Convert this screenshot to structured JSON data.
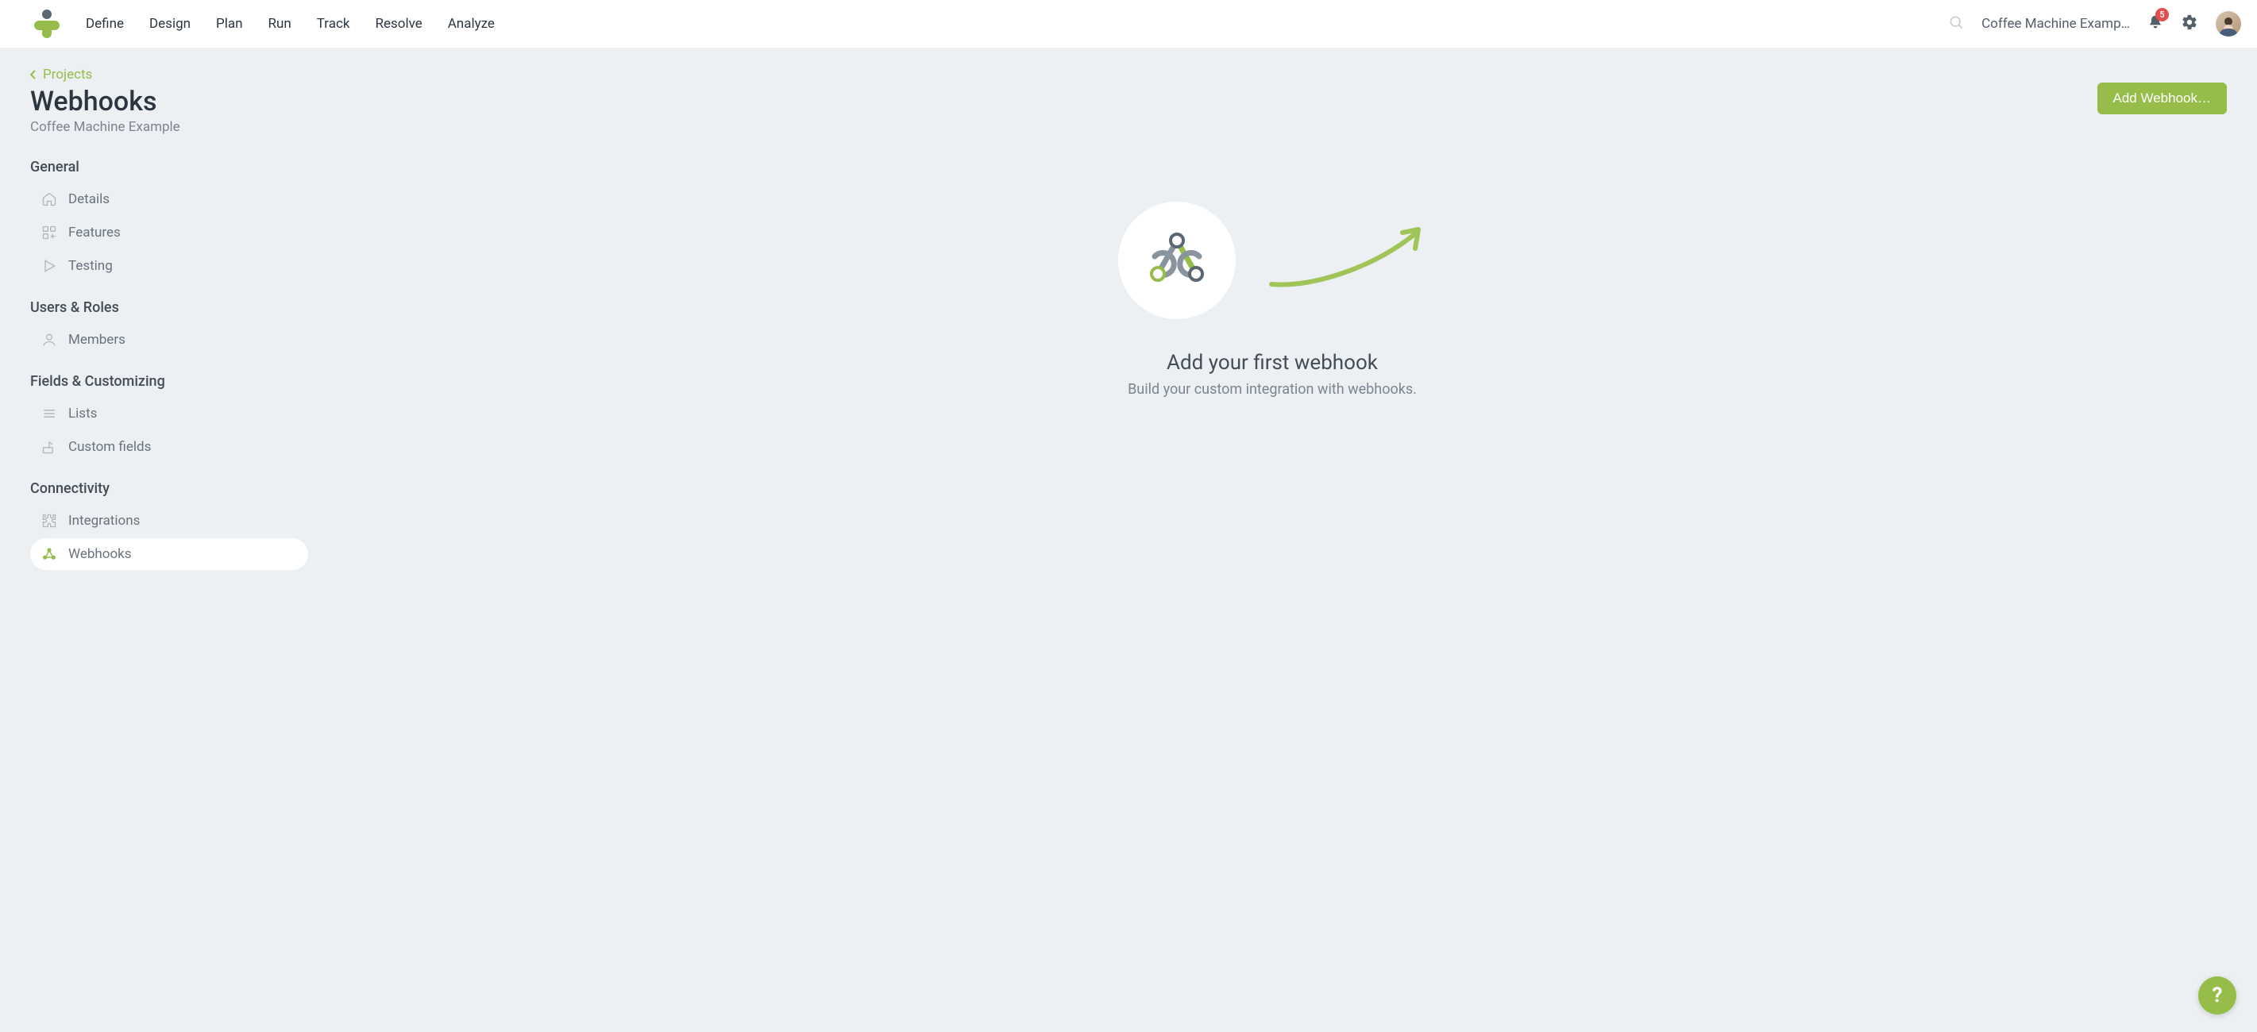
{
  "header": {
    "nav": [
      "Define",
      "Design",
      "Plan",
      "Run",
      "Track",
      "Resolve",
      "Analyze"
    ],
    "project_selector": "Coffee Machine Examp…",
    "notification_count": "5"
  },
  "breadcrumb": {
    "parent_label": "Projects"
  },
  "page": {
    "title": "Webhooks",
    "subtitle": "Coffee Machine Example"
  },
  "sidebar": {
    "sections": [
      {
        "heading": "General",
        "items": [
          {
            "icon": "home-icon",
            "label": "Details",
            "active": false
          },
          {
            "icon": "features-icon",
            "label": "Features",
            "active": false
          },
          {
            "icon": "play-icon",
            "label": "Testing",
            "active": false
          }
        ]
      },
      {
        "heading": "Users & Roles",
        "items": [
          {
            "icon": "user-icon",
            "label": "Members",
            "active": false
          }
        ]
      },
      {
        "heading": "Fields & Customizing",
        "items": [
          {
            "icon": "list-icon",
            "label": "Lists",
            "active": false
          },
          {
            "icon": "custom-fields-icon",
            "label": "Custom fields",
            "active": false
          }
        ]
      },
      {
        "heading": "Connectivity",
        "items": [
          {
            "icon": "puzzle-icon",
            "label": "Integrations",
            "active": false
          },
          {
            "icon": "webhook-icon",
            "label": "Webhooks",
            "active": true
          }
        ]
      }
    ]
  },
  "main": {
    "add_button_label": "Add Webhook…",
    "empty_title": "Add your first webhook",
    "empty_subtitle": "Build your custom integration with webhooks."
  },
  "help": {
    "label": "?"
  }
}
